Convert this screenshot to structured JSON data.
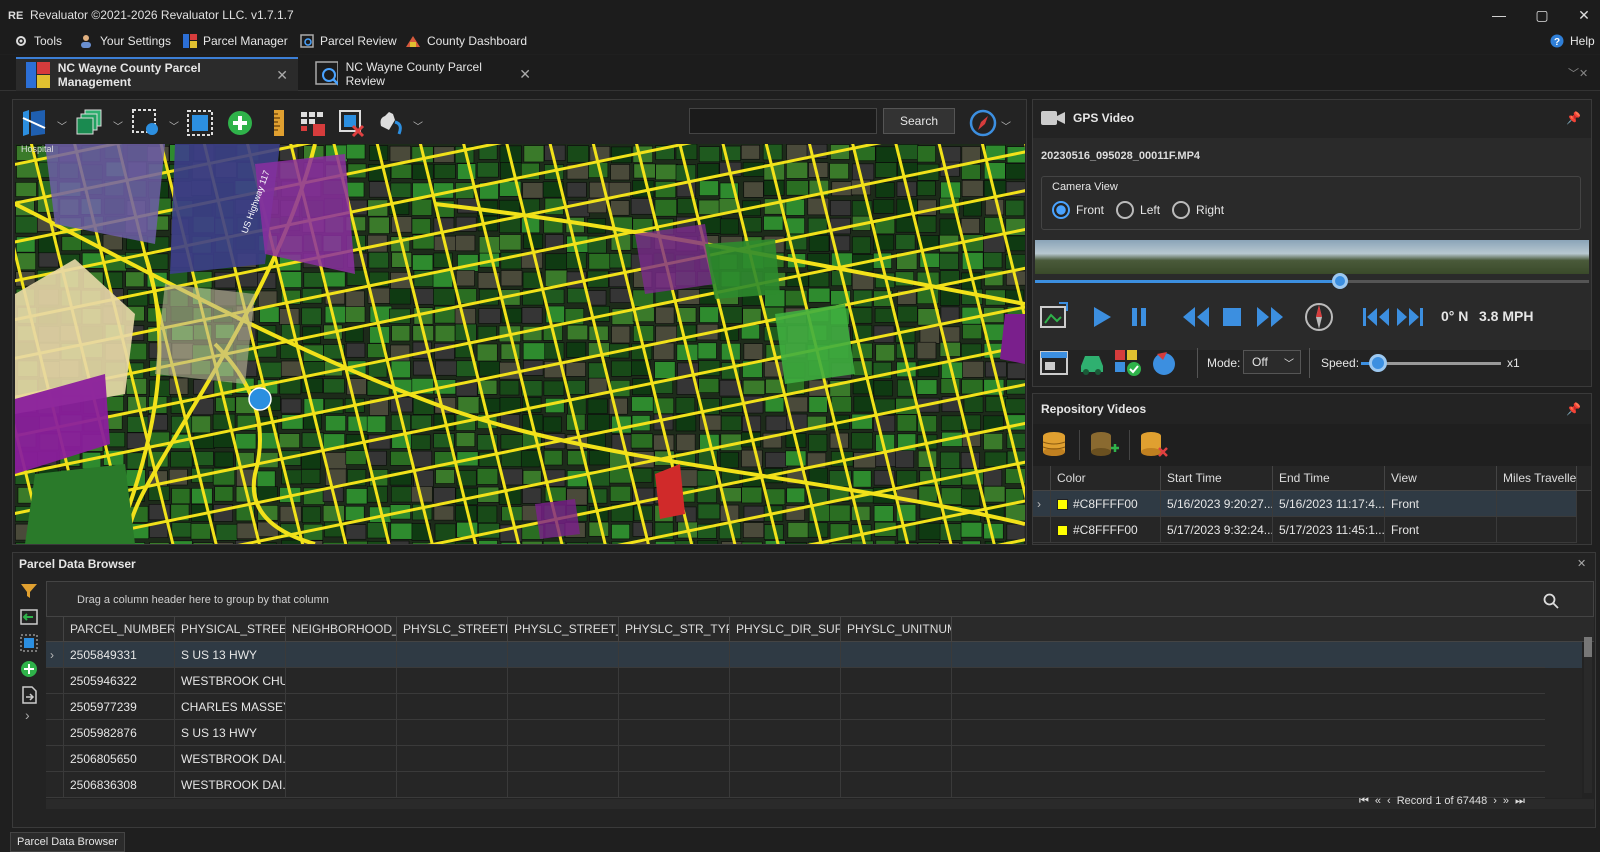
{
  "window": {
    "title": "Revaluator ©2021-2026 Revaluator LLC. v1.7.1.7",
    "minimize": "—",
    "restore": "▢",
    "close": "✕"
  },
  "menu": {
    "items": [
      "Tools",
      "Your Settings",
      "Parcel Manager",
      "Parcel Review",
      "County Dashboard"
    ],
    "help": "Help"
  },
  "doc_tabs": [
    {
      "label": "NC Wayne County Parcel Management",
      "active": true
    },
    {
      "label": "NC Wayne County Parcel Review",
      "active": false
    }
  ],
  "map_toolbar": {
    "search_placeholder": "",
    "search_label": "Search"
  },
  "gps": {
    "title": "GPS Video",
    "file": "20230516_095028_00011F.MP4",
    "camera_view_label": "Camera View",
    "views": [
      "Front",
      "Left",
      "Right"
    ],
    "selected_view": "Front",
    "progress": 0.55,
    "heading": "0° N",
    "speed_readout": "3.8 MPH",
    "mode_label": "Mode:",
    "mode_value": "Off",
    "speed_label": "Speed:",
    "speed_multiplier": "x1",
    "speed_slider": 0.12
  },
  "repository": {
    "title": "Repository Videos",
    "columns": [
      "Color",
      "Start Time",
      "End Time",
      "View",
      "Miles Travelle"
    ],
    "rows": [
      {
        "color": "#C8FFFF00",
        "swatch": "#ffff00",
        "start": "5/16/2023 9:20:27...",
        "end": "5/16/2023 11:17:4...",
        "view": "Front",
        "miles": ""
      },
      {
        "color": "#C8FFFF00",
        "swatch": "#ffff00",
        "start": "5/17/2023 9:32:24...",
        "end": "5/17/2023 11:45:1...",
        "view": "Front",
        "miles": ""
      }
    ]
  },
  "parcel_browser": {
    "title": "Parcel Data Browser",
    "group_hint": "Drag a column header here to group by that column",
    "columns": [
      "PARCEL_NUMBER",
      "PHYSICAL_STREET...",
      "NEIGHBORHOOD_...",
      "PHYSLC_STREETN...",
      "PHYSLC_STREET_N...",
      "PHYSLC_STR_TYPE",
      "PHYSLC_DIR_SUFFIX",
      "PHYSLC_UNITNUM..."
    ],
    "rows": [
      [
        "2505849331",
        "S US 13 HWY"
      ],
      [
        "2505946322",
        "WESTBROOK CHU..."
      ],
      [
        "2505977239",
        "CHARLES MASSEY..."
      ],
      [
        "2505982876",
        "S US 13 HWY"
      ],
      [
        "2506805650",
        "WESTBROOK DAI..."
      ],
      [
        "2506836308",
        "WESTBROOK DAI..."
      ]
    ],
    "record_status": "Record 1 of 67448",
    "bottom_tab": "Parcel Data Browser"
  },
  "map_labels": [
    "Hospital",
    "US Highway 117"
  ],
  "colors": {
    "accent": "#3c8fe0",
    "roads": "#f2e21a",
    "parcel_green": "#2e8b2e",
    "parcel_purple": "#7a1f8c"
  }
}
